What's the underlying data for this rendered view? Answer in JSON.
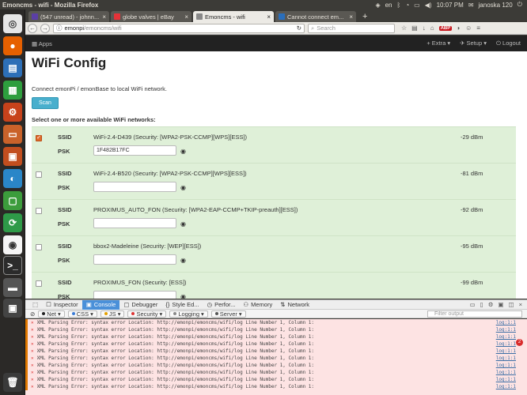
{
  "system": {
    "window_title": "Emoncms - wifi - Mozilla Firefox",
    "keyboard_layout": "en",
    "time": "10:07 PM",
    "user": "janoska 120"
  },
  "browser": {
    "tabs": [
      {
        "label": "(547 unread) - johnn...",
        "fav_color": "#5b3fa6",
        "active": false
      },
      {
        "label": "globe valves | eBay",
        "fav_color": "#e53238",
        "active": false
      },
      {
        "label": "Emoncms - wifi",
        "fav_color": "#888888",
        "active": true
      },
      {
        "label": "Cannot connect em...",
        "fav_color": "#2a6ebb",
        "active": false
      }
    ],
    "new_tab": "+",
    "url_host": "emonpi",
    "url_path": "/emoncms/wifi",
    "search_placeholder": "Search"
  },
  "emoncms_menu": {
    "apps": "Apps",
    "extra": "Extra",
    "setup": "Setup",
    "logout": "Logout"
  },
  "page": {
    "title": "WiFi Config",
    "intro": "Connect emonPi / emonBase to local WiFi network.",
    "scan_label": "Scan",
    "select_heading": "Select one or more available WiFi networks:",
    "ssid_label": "SSID",
    "psk_label": "PSK",
    "networks": [
      {
        "ssid": "WiFi-2.4-D439 (Security: [WPA2-PSK-CCMP][WPS][ESS])",
        "signal": "-29 dBm",
        "psk": "1F482B17FC",
        "checked": true
      },
      {
        "ssid": "WiFi-2.4-B520 (Security: [WPA2-PSK-CCMP][WPS][ESS])",
        "signal": "-81 dBm",
        "psk": "",
        "checked": false
      },
      {
        "ssid": "PROXIMUS_AUTO_FON (Security: [WPA2-EAP-CCMP+TKIP-preauth][ESS])",
        "signal": "-92 dBm",
        "psk": "",
        "checked": false
      },
      {
        "ssid": "bbox2-Madeleine (Security: [WEP][ESS])",
        "signal": "-95 dBm",
        "psk": "",
        "checked": false
      },
      {
        "ssid": "PROXIMUS_FON (Security: [ESS])",
        "signal": "-99 dBm",
        "psk": "",
        "checked": false
      }
    ]
  },
  "devtools": {
    "tabs": [
      "Inspector",
      "Console",
      "Debugger",
      "Style Ed...",
      "Perfor...",
      "Memory",
      "Network"
    ],
    "active_tab": "Console",
    "filters": [
      "Net",
      "CSS",
      "JS",
      "Security",
      "Logging",
      "Server"
    ],
    "filter_placeholder": "Filter output",
    "error_badge": "2",
    "lines": [
      {
        "msg": "XML Parsing Error: syntax error Location: http://emonpi/emoncms/wifi/log Line Number 1, Column 1:",
        "src": "log:1:1"
      },
      {
        "msg": "XML Parsing Error: syntax error Location: http://emonpi/emoncms/wifi/log Line Number 1, Column 1:",
        "src": "log:1:1"
      },
      {
        "msg": "XML Parsing Error: syntax error Location: http://emonpi/emoncms/wifi/log Line Number 1, Column 1:",
        "src": "log:1:1"
      },
      {
        "msg": "XML Parsing Error: syntax error Location: http://emonpi/emoncms/wifi/log Line Number 1, Column 1:",
        "src": "log:1:1"
      },
      {
        "msg": "XML Parsing Error: syntax error Location: http://emonpi/emoncms/wifi/log Line Number 1, Column 1:",
        "src": "log:1:1"
      },
      {
        "msg": "XML Parsing Error: syntax error Location: http://emonpi/emoncms/wifi/log Line Number 1, Column 1:",
        "src": "log:1:1"
      },
      {
        "msg": "XML Parsing Error: syntax error Location: http://emonpi/emoncms/wifi/log Line Number 1, Column 1:",
        "src": "log:1:1"
      },
      {
        "msg": "XML Parsing Error: syntax error Location: http://emonpi/emoncms/wifi/log Line Number 1, Column 1:",
        "src": "log:1:1"
      },
      {
        "msg": "XML Parsing Error: syntax error Location: http://emonpi/emoncms/wifi/log Line Number 1, Column 1:",
        "src": "log:1:1"
      },
      {
        "msg": "XML Parsing Error: syntax error Location: http://emonpi/emoncms/wifi/log Line Number 1, Column 1:",
        "src": "log:1:1"
      }
    ]
  }
}
